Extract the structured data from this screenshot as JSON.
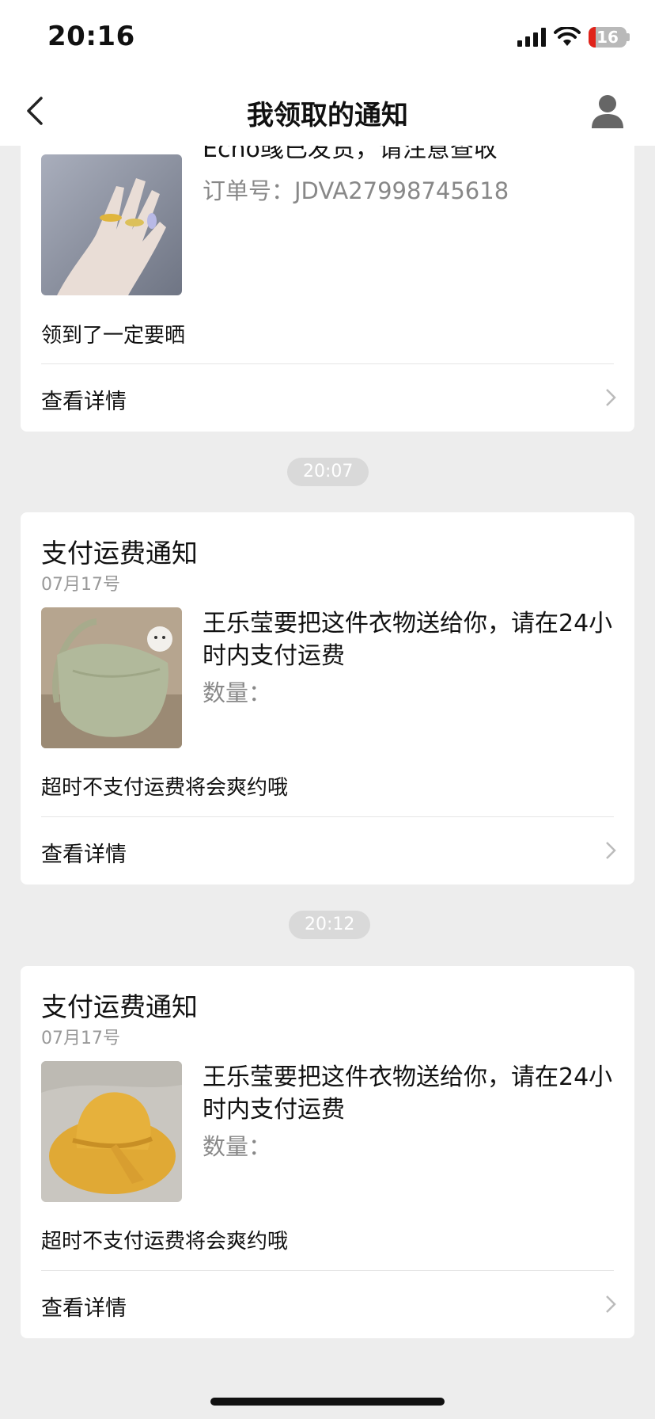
{
  "status_bar": {
    "time": "20:16",
    "battery_level": "16",
    "icons": [
      "signal-icon",
      "wifi-icon",
      "battery-icon"
    ]
  },
  "nav": {
    "title": "我领取的通知",
    "back_icon": "chevron-left-icon",
    "profile_icon": "user-icon"
  },
  "cards": [
    {
      "desc": "Echo彧已发货，请注意查收",
      "sub": "订单号：JDVA27998745618",
      "note": "领到了一定要晒",
      "link": "查看详情"
    },
    {
      "time": "20:07",
      "title": "支付运费通知",
      "date": "07月17号",
      "desc": "王乐莹要把这件衣物送给你，请在24小时内支付运费",
      "sub": "数量：",
      "note": "超时不支付运费将会爽约哦",
      "link": "查看详情"
    },
    {
      "time": "20:12",
      "title": "支付运费通知",
      "date": "07月17号",
      "desc": "王乐莹要把这件衣物送给你，请在24小时内支付运费",
      "sub": "数量：",
      "note": "超时不支付运费将会爽约哦",
      "link": "查看详情"
    }
  ]
}
